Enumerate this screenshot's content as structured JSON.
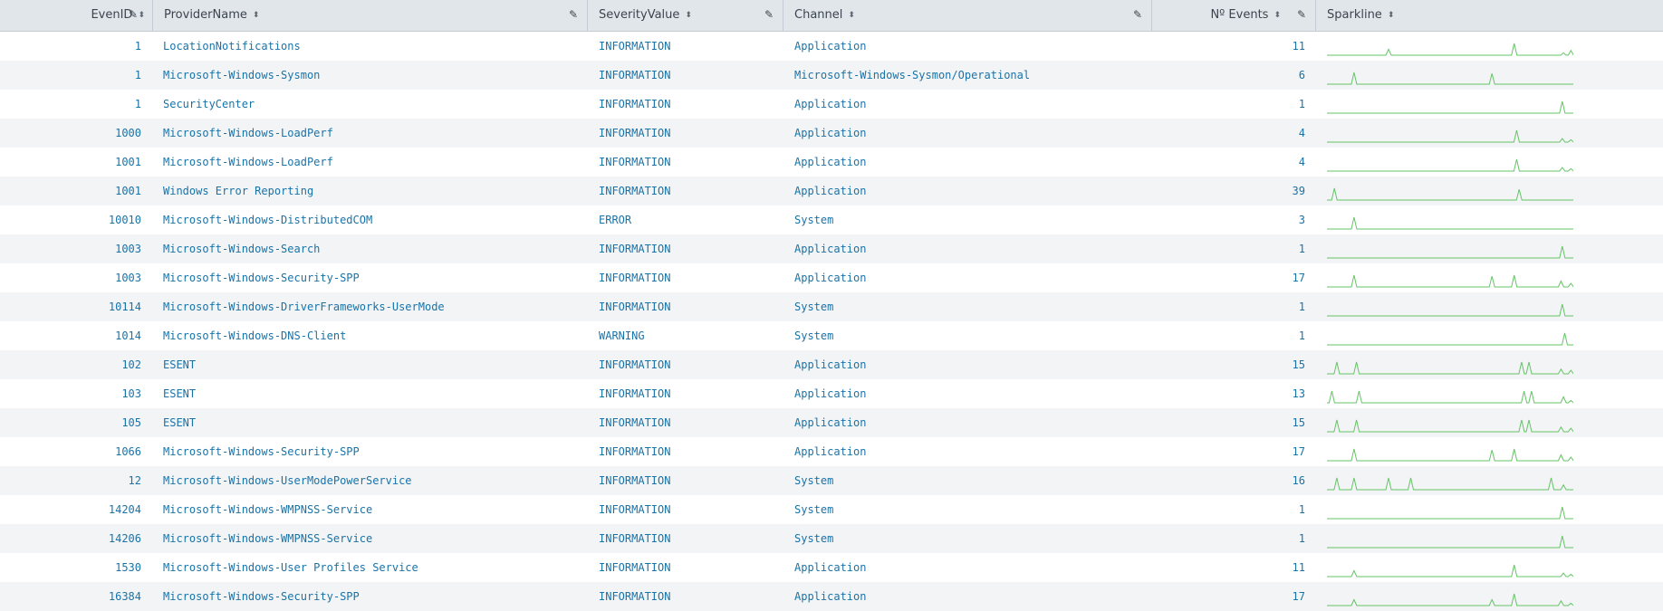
{
  "columns": [
    {
      "label": "EvenID"
    },
    {
      "label": "ProviderName"
    },
    {
      "label": "SeverityValue"
    },
    {
      "label": "Channel"
    },
    {
      "label": "Nº Events"
    },
    {
      "label": "Sparkline"
    }
  ],
  "rows": [
    {
      "id": "1",
      "provider": "LocationNotifications",
      "severity": "INFORMATION",
      "channel": "Application",
      "count": "11",
      "spark": [
        [
          0.25,
          0.5
        ],
        [
          0.76,
          1
        ],
        [
          0.96,
          0.2
        ],
        [
          0.99,
          0.4
        ]
      ]
    },
    {
      "id": "1",
      "provider": "Microsoft-Windows-Sysmon",
      "severity": "INFORMATION",
      "channel": "Microsoft-Windows-Sysmon/Operational",
      "count": "6",
      "spark": [
        [
          0.11,
          1
        ],
        [
          0.67,
          0.9
        ]
      ]
    },
    {
      "id": "1",
      "provider": "SecurityCenter",
      "severity": "INFORMATION",
      "channel": "Application",
      "count": "1",
      "spark": [
        [
          0.955,
          1
        ]
      ]
    },
    {
      "id": "1000",
      "provider": "Microsoft-Windows-LoadPerf",
      "severity": "INFORMATION",
      "channel": "Application",
      "count": "4",
      "spark": [
        [
          0.77,
          1
        ],
        [
          0.955,
          0.3
        ],
        [
          0.99,
          0.2
        ]
      ]
    },
    {
      "id": "1001",
      "provider": "Microsoft-Windows-LoadPerf",
      "severity": "INFORMATION",
      "channel": "Application",
      "count": "4",
      "spark": [
        [
          0.77,
          1
        ],
        [
          0.955,
          0.3
        ],
        [
          0.99,
          0.2
        ]
      ]
    },
    {
      "id": "1001",
      "provider": "Windows Error Reporting",
      "severity": "INFORMATION",
      "channel": "Application",
      "count": "39",
      "spark": [
        [
          0.03,
          1
        ],
        [
          0.78,
          0.9
        ]
      ]
    },
    {
      "id": "10010",
      "provider": "Microsoft-Windows-DistributedCOM",
      "severity": "ERROR",
      "channel": "System",
      "count": "3",
      "spark": [
        [
          0.11,
          1
        ]
      ]
    },
    {
      "id": "1003",
      "provider": "Microsoft-Windows-Search",
      "severity": "INFORMATION",
      "channel": "Application",
      "count": "1",
      "spark": [
        [
          0.955,
          1
        ]
      ]
    },
    {
      "id": "1003",
      "provider": "Microsoft-Windows-Security-SPP",
      "severity": "INFORMATION",
      "channel": "Application",
      "count": "17",
      "spark": [
        [
          0.11,
          1
        ],
        [
          0.67,
          0.9
        ],
        [
          0.76,
          1
        ],
        [
          0.95,
          0.5
        ],
        [
          0.99,
          0.3
        ]
      ]
    },
    {
      "id": "10114",
      "provider": "Microsoft-Windows-DriverFrameworks-UserMode",
      "severity": "INFORMATION",
      "channel": "System",
      "count": "1",
      "spark": [
        [
          0.955,
          1
        ]
      ]
    },
    {
      "id": "1014",
      "provider": "Microsoft-Windows-DNS-Client",
      "severity": "WARNING",
      "channel": "System",
      "count": "1",
      "spark": [
        [
          0.965,
          1
        ]
      ]
    },
    {
      "id": "102",
      "provider": "ESENT",
      "severity": "INFORMATION",
      "channel": "Application",
      "count": "15",
      "spark": [
        [
          0.04,
          1
        ],
        [
          0.12,
          1
        ],
        [
          0.79,
          1
        ],
        [
          0.82,
          1
        ],
        [
          0.95,
          0.4
        ],
        [
          0.99,
          0.3
        ]
      ]
    },
    {
      "id": "103",
      "provider": "ESENT",
      "severity": "INFORMATION",
      "channel": "Application",
      "count": "13",
      "spark": [
        [
          0.02,
          1
        ],
        [
          0.13,
          1
        ],
        [
          0.8,
          1
        ],
        [
          0.83,
          1
        ],
        [
          0.96,
          0.5
        ],
        [
          0.99,
          0.2
        ]
      ]
    },
    {
      "id": "105",
      "provider": "ESENT",
      "severity": "INFORMATION",
      "channel": "Application",
      "count": "15",
      "spark": [
        [
          0.04,
          1
        ],
        [
          0.12,
          1
        ],
        [
          0.79,
          1
        ],
        [
          0.82,
          1
        ],
        [
          0.95,
          0.4
        ],
        [
          0.99,
          0.3
        ]
      ]
    },
    {
      "id": "1066",
      "provider": "Microsoft-Windows-Security-SPP",
      "severity": "INFORMATION",
      "channel": "Application",
      "count": "17",
      "spark": [
        [
          0.11,
          1
        ],
        [
          0.67,
          0.9
        ],
        [
          0.76,
          1
        ],
        [
          0.95,
          0.5
        ],
        [
          0.99,
          0.3
        ]
      ]
    },
    {
      "id": "12",
      "provider": "Microsoft-Windows-UserModePowerService",
      "severity": "INFORMATION",
      "channel": "System",
      "count": "16",
      "spark": [
        [
          0.04,
          1
        ],
        [
          0.11,
          1
        ],
        [
          0.25,
          1
        ],
        [
          0.34,
          1
        ],
        [
          0.91,
          1
        ],
        [
          0.96,
          0.4
        ]
      ]
    },
    {
      "id": "14204",
      "provider": "Microsoft-Windows-WMPNSS-Service",
      "severity": "INFORMATION",
      "channel": "System",
      "count": "1",
      "spark": [
        [
          0.955,
          1
        ]
      ]
    },
    {
      "id": "14206",
      "provider": "Microsoft-Windows-WMPNSS-Service",
      "severity": "INFORMATION",
      "channel": "System",
      "count": "1",
      "spark": [
        [
          0.955,
          1
        ]
      ]
    },
    {
      "id": "1530",
      "provider": "Microsoft-Windows-User Profiles Service",
      "severity": "INFORMATION",
      "channel": "Application",
      "count": "11",
      "spark": [
        [
          0.11,
          0.5
        ],
        [
          0.76,
          1
        ],
        [
          0.96,
          0.3
        ],
        [
          0.99,
          0.2
        ]
      ]
    },
    {
      "id": "16384",
      "provider": "Microsoft-Windows-Security-SPP",
      "severity": "INFORMATION",
      "channel": "Application",
      "count": "17",
      "spark": [
        [
          0.11,
          0.5
        ],
        [
          0.67,
          0.5
        ],
        [
          0.76,
          1
        ],
        [
          0.95,
          0.4
        ],
        [
          0.99,
          0.2
        ]
      ]
    }
  ],
  "colors": {
    "link": "#1a73a8",
    "header_bg": "#e1e6eb",
    "stripe": "#f2f4f5",
    "spark": "#65c466"
  },
  "icons": {
    "sort": "sort-arrows-icon",
    "edit": "pencil-icon"
  }
}
